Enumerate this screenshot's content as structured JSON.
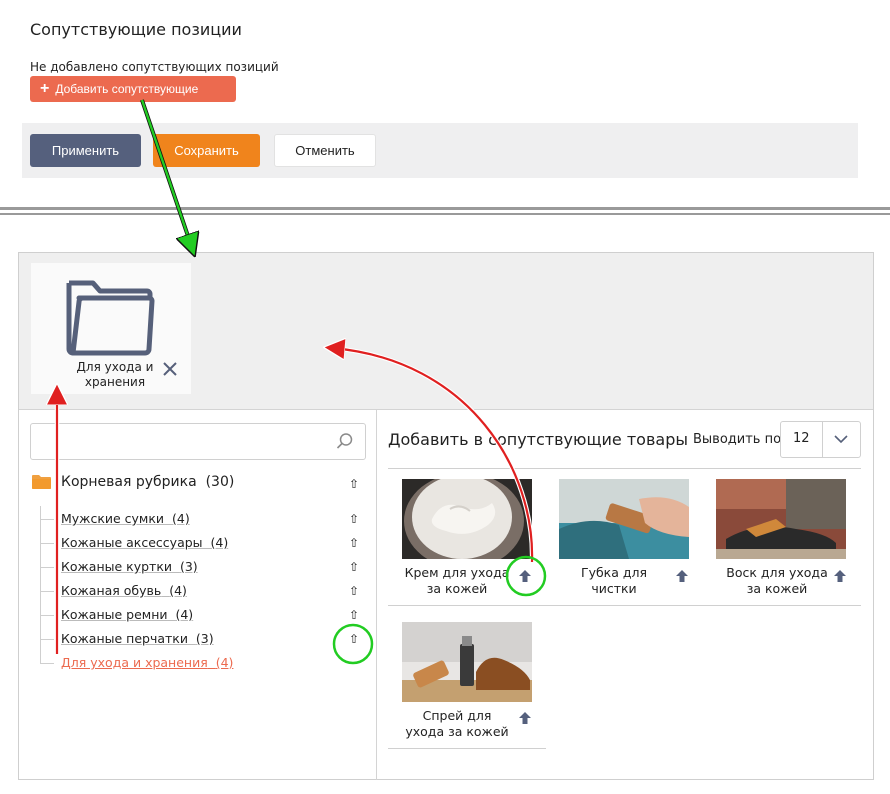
{
  "section": {
    "title": "Сопутствующие позиции",
    "empty_note": "Не добавлено сопутствующих позиций",
    "add_button": "Добавить сопутствующие",
    "add_button_plus": "+"
  },
  "actions": {
    "apply": "Применить",
    "save": "Сохранить",
    "cancel": "Отменить"
  },
  "selected_chip": {
    "label": "Для ухода и хранения",
    "icon": "folder-outline-icon",
    "remove_icon": "close-icon"
  },
  "search": {
    "value": "",
    "placeholder": "",
    "icon": "search-icon"
  },
  "tree": {
    "root_label": "Корневая рубрика",
    "root_count": "(30)",
    "items": [
      {
        "label": "Мужские сумки",
        "count": "(4)"
      },
      {
        "label": "Кожаные аксессуары",
        "count": "(4)"
      },
      {
        "label": "Кожаные куртки",
        "count": "(3)"
      },
      {
        "label": "Кожаная обувь",
        "count": "(4)"
      },
      {
        "label": "Кожаные ремни",
        "count": "(4)"
      },
      {
        "label": "Кожаные перчатки",
        "count": "(3)"
      },
      {
        "label": "Для ухода и хранения",
        "count": "(4)",
        "active": true
      }
    ],
    "add_icon": "arrow-up-outline-icon"
  },
  "products": {
    "title": "Добавить в сопутствующие товары",
    "per_page_label": "Выводить по",
    "per_page_value": "12",
    "items": [
      {
        "name": "Крем для ухода за кожей",
        "image": "cream-jar-photo"
      },
      {
        "name": "Губка для чистки",
        "image": "shoe-brush-photo"
      },
      {
        "name": "Воск для ухода за кожей",
        "image": "shoe-polishing-photo"
      },
      {
        "name": "Спрей для ухода за кожей",
        "image": "spray-and-boots-photo"
      }
    ],
    "add_icon": "arrow-up-filled-icon"
  },
  "colors": {
    "accent": "#ec6a4f",
    "apply": "#55607d",
    "save": "#f0841c",
    "annotation_green": "#22cc22",
    "annotation_red": "#e02020"
  }
}
